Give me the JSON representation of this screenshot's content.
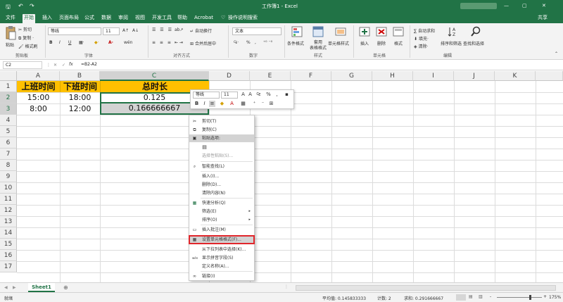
{
  "titlebar": {
    "save_icon": "save-icon",
    "undo_icon": "undo-icon",
    "redo_icon": "redo-icon",
    "title": "工作簿1 - Excel",
    "account_label": "",
    "close_glyph": "✕",
    "min_glyph": "—",
    "max_glyph": "▢"
  },
  "tabs": [
    {
      "label": "文件"
    },
    {
      "label": "开始"
    },
    {
      "label": "插入"
    },
    {
      "label": "页面布局"
    },
    {
      "label": "公式"
    },
    {
      "label": "数据"
    },
    {
      "label": "审阅"
    },
    {
      "label": "视图"
    },
    {
      "label": "开发工具"
    },
    {
      "label": "帮助"
    },
    {
      "label": "Acrobat"
    },
    {
      "label": "操作说明搜索"
    }
  ],
  "share_label": "共享",
  "ribbon": {
    "clipboard": {
      "paste": "粘贴",
      "cut": "剪切",
      "copy": "复制 ·",
      "format_painter": "格式刷",
      "group": "剪贴板"
    },
    "font": {
      "name": "等线",
      "size": "11",
      "group": "字体",
      "bold": "B",
      "italic": "I",
      "underline": "U",
      "grow": "A↑",
      "shrink": "A↓",
      "wen": "wén"
    },
    "align": {
      "wrap": "自动换行",
      "merge": "合并后居中",
      "group": "对齐方式"
    },
    "number": {
      "format": "文本",
      "group": "数字",
      "pct": "%",
      "comma": ","
    },
    "styles": {
      "cond": "条件格式",
      "table1": "套用",
      "table2": "表格格式",
      "cell": "单元格样式",
      "group": "样式"
    },
    "cells": {
      "insert": "插入",
      "delete": "删除",
      "format": "格式",
      "group": "单元格"
    },
    "edit": {
      "autosum": "∑ 自动求和",
      "fill": "填充·",
      "clear": "清除·",
      "sort": "排序和筛选",
      "find": "查找和选择",
      "group": "编辑"
    }
  },
  "formula_bar": {
    "name_box": "C2",
    "fx": "fx",
    "formula": "=B2-A2"
  },
  "columns": [
    "A",
    "B",
    "C",
    "D",
    "E",
    "F",
    "G",
    "H",
    "I",
    "J",
    "K"
  ],
  "rows": [
    "1",
    "2",
    "3",
    "4",
    "5",
    "6",
    "7",
    "8",
    "9",
    "10",
    "11",
    "12",
    "13",
    "14",
    "15",
    "16",
    "17"
  ],
  "cells": {
    "A1": "上班时间",
    "B1": "下班时间",
    "C1": "总时长",
    "A2": "15:00",
    "B2": "18:00",
    "C2": "0.125",
    "A3": "8:00",
    "B3": "12:00",
    "C3": "0.166666667"
  },
  "mini_toolbar": {
    "font": "等线",
    "size": "11",
    "bold": "B",
    "italic": "I",
    "pct": "%",
    "comma": ","
  },
  "context_menu": [
    {
      "label": "剪切(T)",
      "icon": "scissors-icon",
      "glyph": "✂",
      "state": "normal"
    },
    {
      "label": "复制(C)",
      "icon": "copy-icon",
      "glyph": "⧉",
      "state": "normal"
    },
    {
      "label": "粘贴选项:",
      "icon": "paste-icon",
      "glyph": "▣",
      "state": "hover"
    },
    {
      "label": "",
      "icon": "paste-option-icon",
      "glyph": "▤",
      "state": "normal"
    },
    {
      "label": "选择性粘贴(S)...",
      "icon": "",
      "glyph": "",
      "state": "disabled"
    },
    {
      "label": "智能查找(L)",
      "icon": "search-icon",
      "glyph": "⌕",
      "state": "normal"
    },
    {
      "label": "插入(I)...",
      "icon": "",
      "glyph": "",
      "state": "normal"
    },
    {
      "label": "删除(D)...",
      "icon": "",
      "glyph": "",
      "state": "normal"
    },
    {
      "label": "清除内容(N)",
      "icon": "",
      "glyph": "",
      "state": "normal"
    },
    {
      "label": "快速分析(Q)",
      "icon": "quick-analysis-icon",
      "glyph": "▦",
      "state": "normal"
    },
    {
      "label": "筛选(E)",
      "icon": "",
      "glyph": "",
      "state": "normal",
      "sub": "▸"
    },
    {
      "label": "排序(O)",
      "icon": "",
      "glyph": "",
      "state": "normal",
      "sub": "▸"
    },
    {
      "label": "插入批注(M)",
      "icon": "comment-icon",
      "glyph": "▭",
      "state": "normal"
    },
    {
      "label": "设置单元格格式(F)...",
      "icon": "format-cells-icon",
      "glyph": "▦",
      "state": "highlight"
    },
    {
      "label": "从下拉列表中选择(K)...",
      "icon": "",
      "glyph": "",
      "state": "normal"
    },
    {
      "label": "显示拼音字段(S)",
      "icon": "phonetic-icon",
      "glyph": "wén",
      "state": "normal"
    },
    {
      "label": "定义名称(A)...",
      "icon": "",
      "glyph": "",
      "state": "normal"
    },
    {
      "label": "链接(I)",
      "icon": "link-icon",
      "glyph": "∞",
      "state": "normal"
    }
  ],
  "sheet": {
    "tab": "Sheet1",
    "add": "⊕"
  },
  "status": {
    "mode": "就绪",
    "average": "平均值: 0.145833333",
    "count": "计数: 2",
    "sum": "求和: 0.291666667",
    "zoom": "175%",
    "minus": "-",
    "plus": "+"
  },
  "colors": {
    "excel_green": "#217346",
    "header_fill": "#FFC000",
    "highlight_box": "#E0262B"
  }
}
